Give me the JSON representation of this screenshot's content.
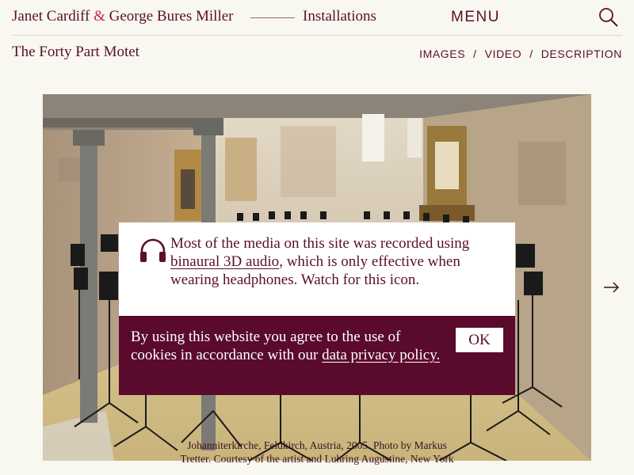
{
  "header": {
    "artist_first": "Janet Cardiff",
    "amp": "&",
    "artist_second": "George Bures Miller",
    "section": "Installations",
    "menu_label": "MENU",
    "search_icon": "search-icon"
  },
  "work": {
    "title": "The Forty Part Motet"
  },
  "subnav": {
    "images": "IMAGES",
    "video": "VIDEO",
    "description": "DESCRIPTION",
    "separator": "/"
  },
  "photo": {
    "caption": "Johanniterkirche, Feldkirch, Austria, 2005. Photo by Markus Tretter. Courtesy of the artist and Luhring Augustine, New York",
    "next_icon": "arrow-right-icon"
  },
  "notice": {
    "icon": "headphones-icon",
    "text_before": "Most of the media on this site was recorded using ",
    "link_text": "binaural 3D audio",
    "text_after": ", which is only effective when wearing headphones. Watch for this icon."
  },
  "cookie": {
    "text_before": "By using this website you agree to the use of cookies in accordance with our ",
    "link_text": "data privacy policy.",
    "ok_label": "OK"
  },
  "colors": {
    "brand": "#5a0f2e",
    "accent": "#c8235a",
    "background": "#f8f7f0",
    "banner": "#5a0a2d"
  }
}
